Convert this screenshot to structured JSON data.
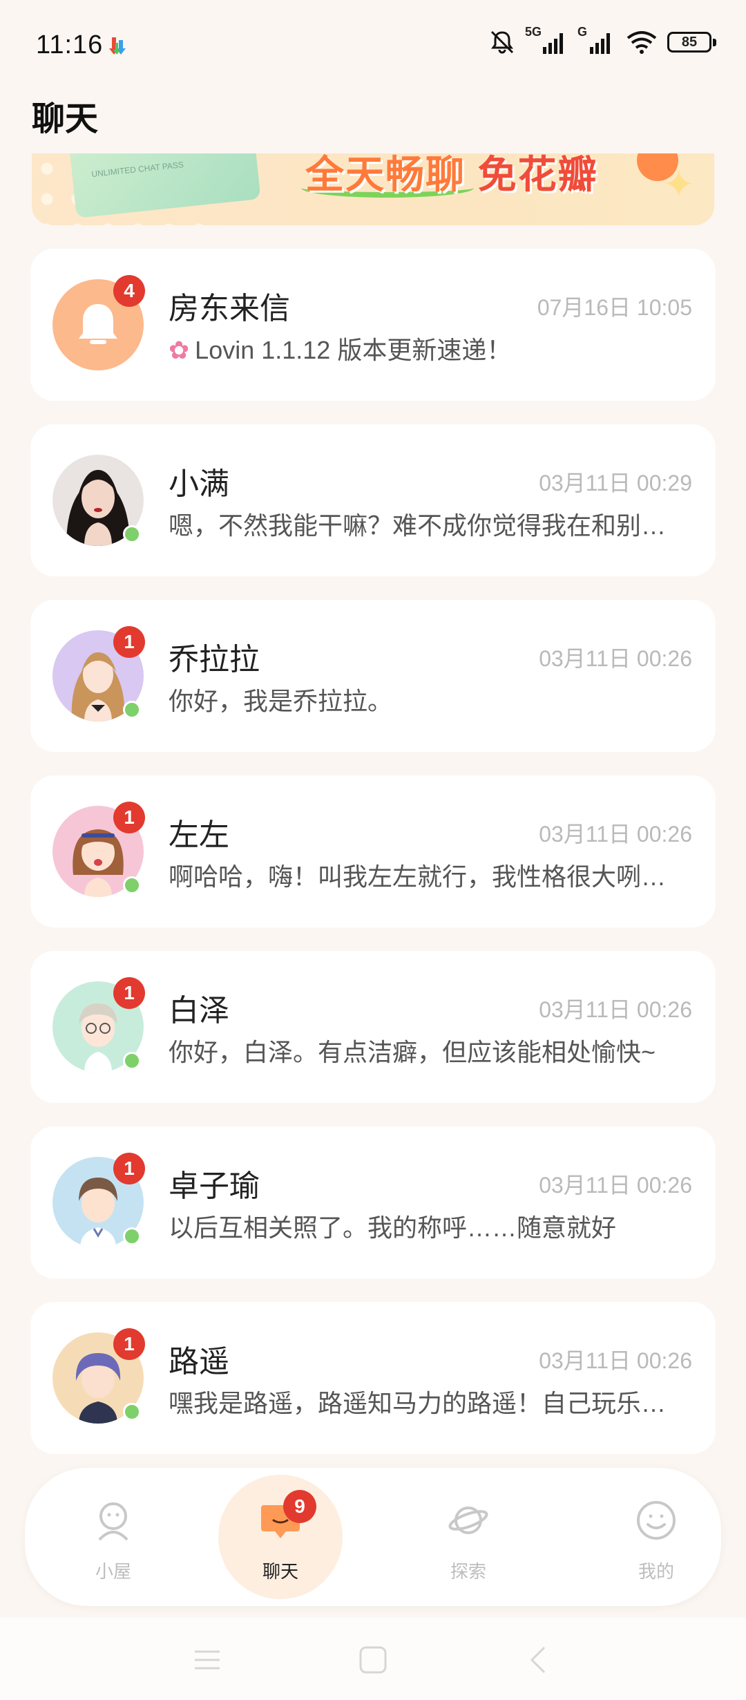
{
  "status_bar": {
    "time": "11:16",
    "signal_1": "5G",
    "signal_2": "G",
    "battery": "85"
  },
  "header": {
    "title": "聊天"
  },
  "banner": {
    "card_text": "UNLIMITED CHAT PASS",
    "text_part1": "全天畅聊",
    "text_part2": "免花瓣"
  },
  "chats": [
    {
      "name": "房东来信",
      "time": "07月16日 10:05",
      "preview": "Lovin 1.1.12 版本更新速递！",
      "unread": "4",
      "online": false,
      "avatar": "bell-icon",
      "avatar_bg": "#fcb98c"
    },
    {
      "name": "小满",
      "time": "03月11日 00:29",
      "preview": "嗯，不然我能干嘛？难不成你觉得我在和别人聊天吗？",
      "unread": "",
      "online": true,
      "avatar": "avatar-xiaoman",
      "avatar_bg": "#e9e4e1"
    },
    {
      "name": "乔拉拉",
      "time": "03月11日 00:26",
      "preview": "你好，我是乔拉拉。",
      "unread": "1",
      "online": true,
      "avatar": "avatar-qiaolala",
      "avatar_bg": "#d8c8f2"
    },
    {
      "name": "左左",
      "time": "03月11日 00:26",
      "preview": "啊哈哈，嗨！叫我左左就行，我性格很大咧咧的哦！",
      "unread": "1",
      "online": true,
      "avatar": "avatar-zuozuo",
      "avatar_bg": "#f7c6d6"
    },
    {
      "name": "白泽",
      "time": "03月11日 00:26",
      "preview": "你好，白泽。有点洁癖，但应该能相处愉快~",
      "unread": "1",
      "online": true,
      "avatar": "avatar-baize",
      "avatar_bg": "#c8ecdc"
    },
    {
      "name": "卓子瑜",
      "time": "03月11日 00:26",
      "preview": "以后互相关照了。我的称呼……随意就好",
      "unread": "1",
      "online": true,
      "avatar": "avatar-zhuoziyu",
      "avatar_bg": "#c5e2f3"
    },
    {
      "name": "路遥",
      "time": "03月11日 00:26",
      "preview": "嘿我是路遥，路遥知马力的路遥！自己玩乐队的哦！",
      "unread": "1",
      "online": true,
      "avatar": "avatar-luyao",
      "avatar_bg": "#f6dcb6"
    }
  ],
  "bottom_nav": {
    "items": [
      {
        "label": "小屋",
        "icon": "face-icon",
        "active": false
      },
      {
        "label": "聊天",
        "icon": "chat-icon",
        "active": true,
        "badge": "9"
      },
      {
        "label": "探索",
        "icon": "planet-icon",
        "active": false
      },
      {
        "label": "我的",
        "icon": "smile-icon",
        "active": false
      }
    ]
  },
  "colors": {
    "background": "#fbf6f2",
    "badge": "#e23a2e",
    "online": "#7ed06a",
    "accent": "#ff8c4a"
  }
}
